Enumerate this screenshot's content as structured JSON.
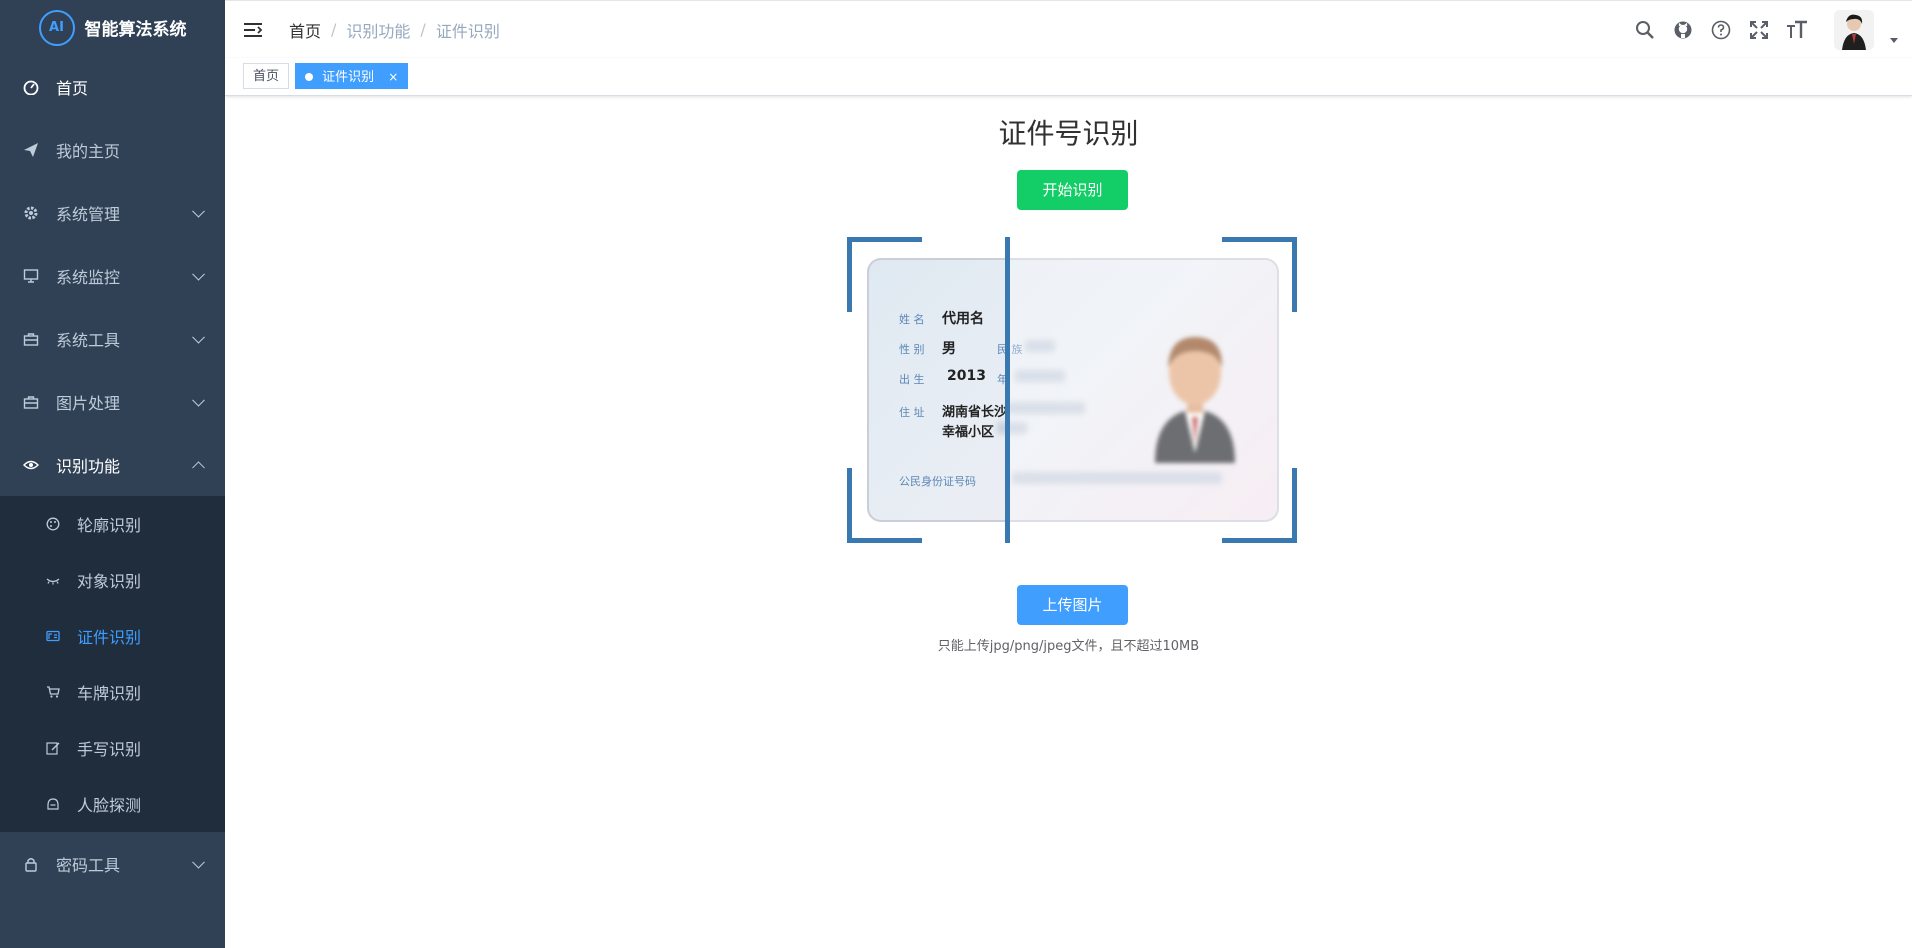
{
  "app": {
    "title": "智能算法系统",
    "logo_text": "AI"
  },
  "sidebar": {
    "items": [
      {
        "label": "首页",
        "icon": "dashboard-icon"
      },
      {
        "label": "我的主页",
        "icon": "send-icon"
      },
      {
        "label": "系统管理",
        "icon": "gear-icon"
      },
      {
        "label": "系统监控",
        "icon": "monitor-icon"
      },
      {
        "label": "系统工具",
        "icon": "toolbox-icon"
      },
      {
        "label": "图片处理",
        "icon": "toolbox-icon"
      },
      {
        "label": "识别功能",
        "icon": "eye-icon"
      },
      {
        "label": "密码工具",
        "icon": "lock-icon"
      }
    ],
    "sub_items": [
      {
        "label": "轮廓识别",
        "icon": "palette-icon"
      },
      {
        "label": "对象识别",
        "icon": "eye-closed-icon"
      },
      {
        "label": "证件识别",
        "icon": "id-card-icon"
      },
      {
        "label": "车牌识别",
        "icon": "cart-icon"
      },
      {
        "label": "手写识别",
        "icon": "edit-icon"
      },
      {
        "label": "人脸探测",
        "icon": "face-icon"
      }
    ]
  },
  "navbar": {
    "breadcrumb": [
      "首页",
      "识别功能",
      "证件识别"
    ]
  },
  "tags": {
    "home": "首页",
    "active": "证件识别",
    "close": "×"
  },
  "main": {
    "title": "证件号识别",
    "start_button": "开始识别",
    "upload_button": "上传图片",
    "tip": "只能上传jpg/png/jpeg文件，且不超过10MB"
  },
  "id_card": {
    "name_label": "姓 名",
    "name_value": "代用名",
    "gender_label": "性 别",
    "gender_value": "男",
    "ethnicity_label": "民 族",
    "birth_label": "出 生",
    "birth_value": "2013",
    "year_label": "年",
    "address_label": "住 址",
    "address_line1": "湖南省长沙",
    "address_line2": "幸福小区",
    "id_label": "公民身份证号码"
  },
  "colors": {
    "sidebar_bg": "#304156",
    "submenu_bg": "#1f2d3d",
    "accent": "#409eff",
    "success": "#13ce66",
    "scan_frame": "#3a79b0"
  }
}
